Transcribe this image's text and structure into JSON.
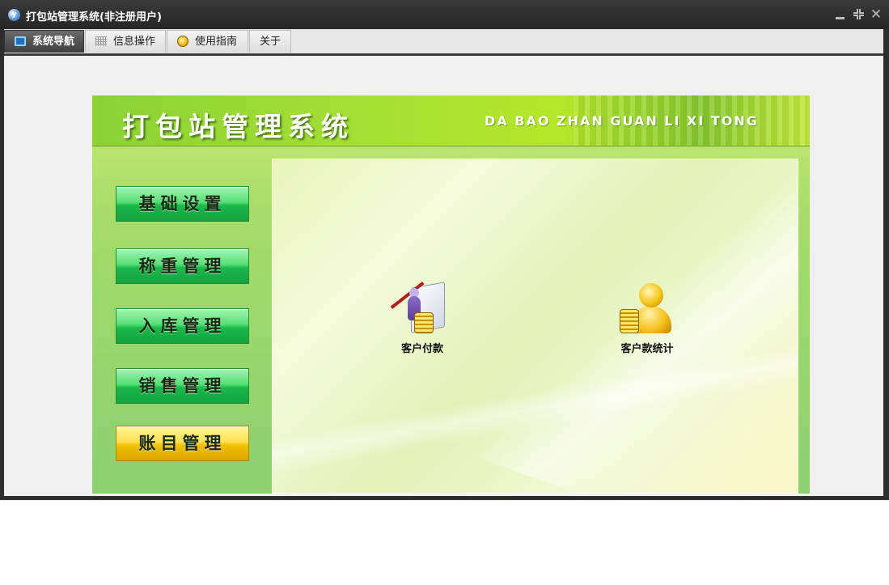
{
  "window": {
    "title": "打包站管理系统(非注册用户)",
    "app_icon": "app-logo-icon",
    "controls": [
      "minimize-icon",
      "restore-icon",
      "close-icon"
    ]
  },
  "tabs": [
    {
      "label": "系统导航",
      "icon": "monitor-icon",
      "active": true
    },
    {
      "label": "信息操作",
      "icon": "grid-icon",
      "active": false
    },
    {
      "label": "使用指南",
      "icon": "coin-icon",
      "active": false
    },
    {
      "label": "关于",
      "icon": "",
      "active": false
    }
  ],
  "panel": {
    "title": "打包站管理系统",
    "subtitle": "DA BAO ZHAN GUAN LI XI TONG"
  },
  "menu": [
    {
      "label": "基础设置",
      "style": "green"
    },
    {
      "label": "称重管理",
      "style": "green"
    },
    {
      "label": "入库管理",
      "style": "green"
    },
    {
      "label": "销售管理",
      "style": "green"
    },
    {
      "label": "账目管理",
      "style": "gold"
    }
  ],
  "shortcuts": [
    {
      "label": "客户付款",
      "icon": "customer-payment-icon"
    },
    {
      "label": "客户款统计",
      "icon": "customer-statistics-icon"
    }
  ],
  "colors": {
    "titlebar": "#2d2d2d",
    "menu_green": "#1bb94b",
    "menu_gold": "#f3c100",
    "header_green": "#a6e033"
  }
}
